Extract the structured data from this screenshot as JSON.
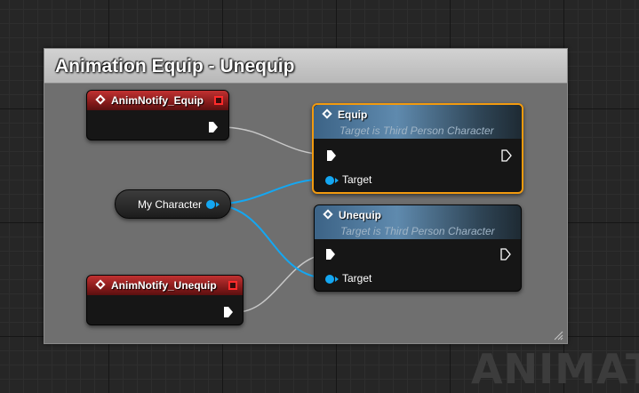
{
  "watermark": "ANIMAT",
  "comment": {
    "title": "Animation Equip - Unequip"
  },
  "nodes": {
    "anim_notify_equip": {
      "title": "AnimNotify_Equip",
      "icon": "event-diamond-icon"
    },
    "anim_notify_unequip": {
      "title": "AnimNotify_Unequip",
      "icon": "event-diamond-icon"
    },
    "my_character": {
      "label": "My Character"
    },
    "equip": {
      "title": "Equip",
      "subtitle": "Target is Third Person Character",
      "target_label": "Target"
    },
    "unequip": {
      "title": "Unequip",
      "subtitle": "Target is Third Person Character",
      "target_label": "Target"
    }
  },
  "colors": {
    "event_header": "#c13131",
    "function_header": "#5f8aae",
    "selection_outline": "#f29a0e",
    "object_wire": "#14a7f2",
    "exec_wire": "#c8c8c8",
    "comment_bg": "#6f6f6f"
  }
}
